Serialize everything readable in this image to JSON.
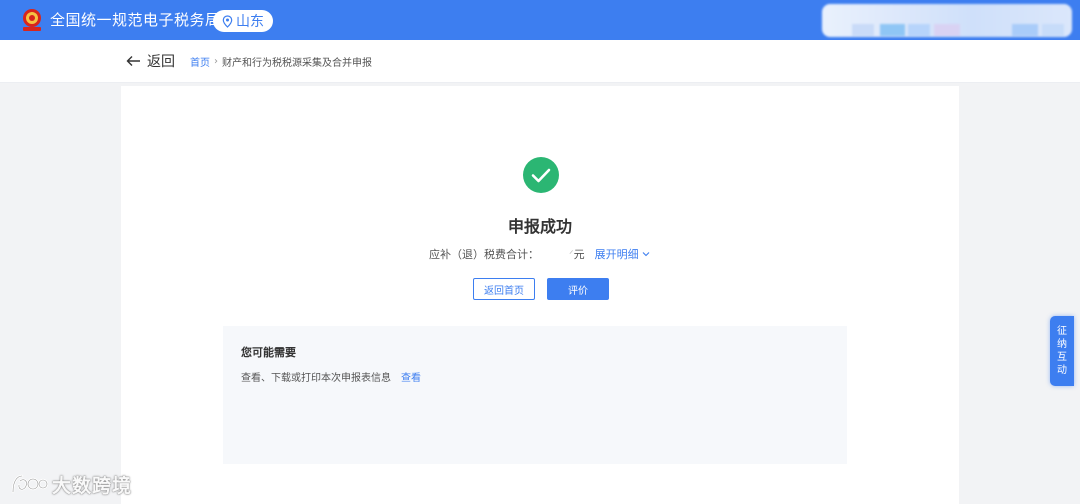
{
  "header": {
    "site_title": "全国统一规范电子税务局",
    "region": "山东"
  },
  "subheader": {
    "back_label": "返回",
    "breadcrumb": {
      "home": "首页",
      "separator": "›",
      "current": "财产和行为税税源采集及合并申报"
    }
  },
  "result": {
    "title": "申报成功",
    "amount_label": "应补（退）税费合计：",
    "amount_value": "ᐟ",
    "amount_unit": "元",
    "expand_label": "展开明细",
    "buttons": {
      "home": "返回首页",
      "rate": "评价"
    }
  },
  "suggestions": {
    "title": "您可能需要",
    "item_text": "查看、下载或打印本次申报表信息",
    "item_link": "查看"
  },
  "side_tab": {
    "label": "征纳互动"
  },
  "watermark": {
    "text": "大数跨境"
  },
  "colors": {
    "brand_blue": "#3d7ef0",
    "success_green": "#2bb673",
    "page_bg": "#f2f3f5"
  },
  "icons": [
    "national-emblem-icon",
    "location-pin-icon",
    "arrow-left-icon",
    "chevron-right-icon",
    "check-circle-icon",
    "chevron-down-icon",
    "watermark-logo-icon"
  ]
}
